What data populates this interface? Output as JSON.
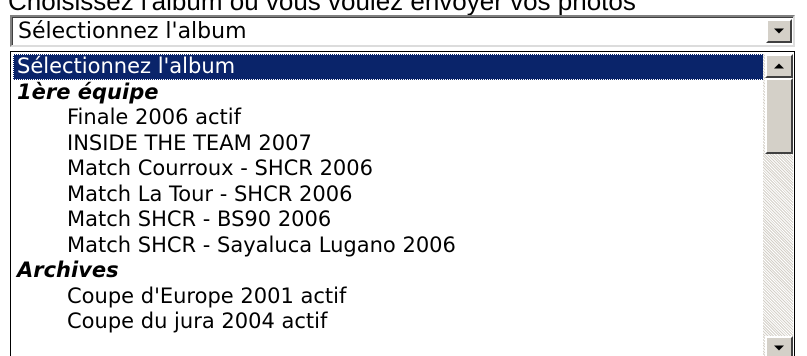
{
  "prompt": "Choisissez l'album où vous voulez envoyer vos photos",
  "select": {
    "value": "Sélectionnez l'album"
  },
  "dropdown": {
    "options": [
      {
        "label": "Sélectionnez l'album",
        "kind": "option",
        "selected": true
      },
      {
        "label": "1ère équipe",
        "kind": "group"
      },
      {
        "label": "Finale 2006 actif",
        "kind": "child"
      },
      {
        "label": "INSIDE THE TEAM 2007",
        "kind": "child"
      },
      {
        "label": "Match Courroux - SHCR 2006",
        "kind": "child"
      },
      {
        "label": "Match La Tour - SHCR 2006",
        "kind": "child"
      },
      {
        "label": "Match SHCR - BS90 2006",
        "kind": "child"
      },
      {
        "label": "Match SHCR - Sayaluca Lugano 2006",
        "kind": "child"
      },
      {
        "label": "Archives",
        "kind": "group"
      },
      {
        "label": "Coupe d'Europe 2001 actif",
        "kind": "child"
      },
      {
        "label": "Coupe du jura 2004 actif",
        "kind": "child"
      }
    ]
  },
  "colors": {
    "highlight": "#0a246a",
    "face": "#d4d0c8"
  },
  "icons": {
    "select_arrow": "chevron-down-icon",
    "scroll_up": "scroll-up-arrow-icon",
    "scroll_down": "scroll-down-arrow-icon"
  }
}
